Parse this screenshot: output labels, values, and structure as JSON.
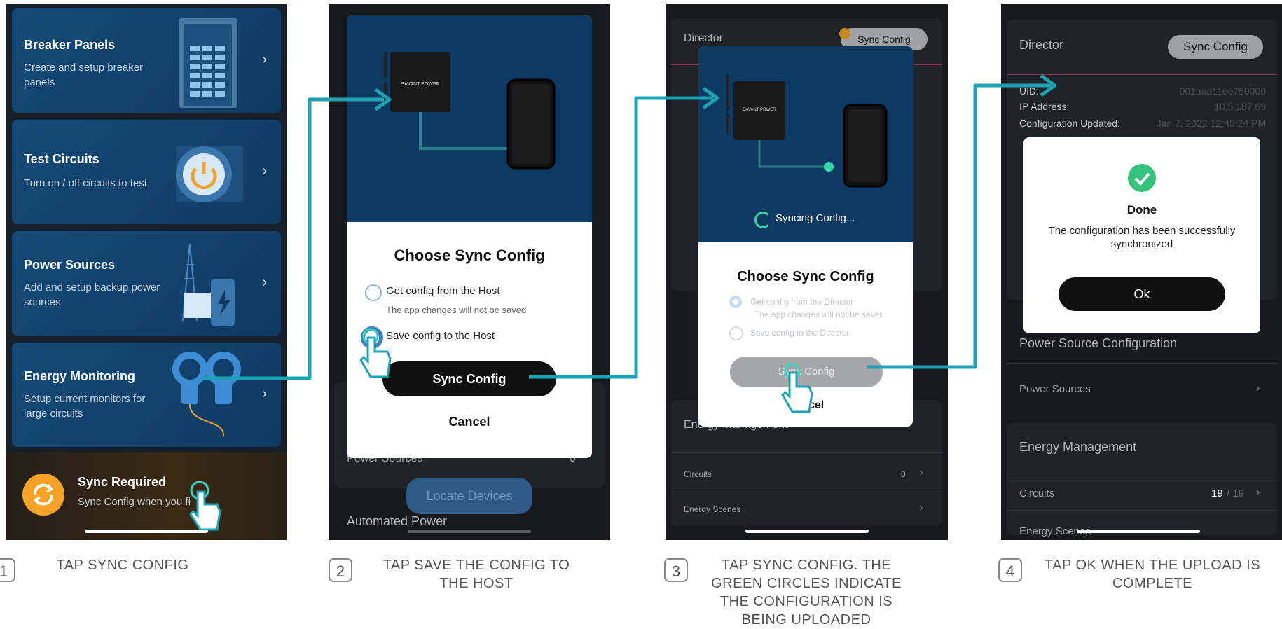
{
  "screen1": {
    "cards": [
      {
        "title": "Breaker Panels",
        "desc": "Create and setup breaker panels"
      },
      {
        "title": "Test Circuits",
        "desc": "Turn on / off circuits to test"
      },
      {
        "title": "Power Sources",
        "desc": "Add and setup backup power sources"
      },
      {
        "title": "Energy Monitoring",
        "desc": "Setup current monitors for large circuits"
      }
    ],
    "sync_title": "Sync Required",
    "sync_desc": "Sync Config when you fi"
  },
  "screen2": {
    "brand": "SAVANT POWER",
    "modal_title": "Choose Sync Config",
    "option1": "Get config from the Host",
    "option1_sub": "The app changes will not be saved",
    "option2": "Save config to the Host",
    "primary_button": "Sync Config",
    "cancel_button": "Cancel",
    "bg_power_sources": "Power Sources",
    "bg_power_sources_count": "0",
    "locate_devices": "Locate Devices",
    "bg_automated_power": "Automated Power"
  },
  "screen3": {
    "director": "Director",
    "sync_pill": "Sync Config",
    "syncing": "Syncing Config...",
    "modal_title": "Choose Sync Config",
    "option1": "Get config from the Director",
    "option1_sub": "The app changes will not be saved",
    "option2": "Save config to the Director",
    "primary_button": "Sync Config",
    "cancel_button": "Cancel",
    "bg_energy_management": "Energy Management",
    "bg_circuits": "Circuits",
    "bg_circuits_count": "0",
    "bg_energy_scenes": "Energy Scenes"
  },
  "screen4": {
    "director": "Director",
    "sync_pill": "Sync Config",
    "uid_label": "UID:",
    "uid_value": "001aae11ee750000",
    "ip_label": "IP Address:",
    "ip_value": "10.5.187.69",
    "updated_label": "Configuration Updated:",
    "updated_value": "Jan 7, 2022 12:45:24 PM",
    "done_title": "Done",
    "done_msg": "The configuration has been successfully synchronized",
    "ok_button": "Ok",
    "power_source_config": "Power Source Configuration",
    "power_sources": "Power Sources",
    "energy_management": "Energy Management",
    "circuits": "Circuits",
    "circuits_count": "19",
    "circuits_total": "/ 19",
    "energy_scenes": "Energy Scenes"
  },
  "captions": [
    {
      "num": "1",
      "text": "TAP SYNC CONFIG"
    },
    {
      "num": "2",
      "text": "TAP SAVE THE CONFIG TO THE HOST"
    },
    {
      "num": "3",
      "text": "TAP SYNC CONFIG. THE GREEN CIRCLES INDICATE THE CONFIGURATION IS BEING UPLOADED"
    },
    {
      "num": "4",
      "text": "TAP OK WHEN THE UPLOAD IS COMPLETE"
    }
  ],
  "colors": {
    "accent_teal": "#1aa3b4",
    "navy": "#0c3a63",
    "sync_orange": "#f5a227",
    "success_green": "#35c27a"
  }
}
